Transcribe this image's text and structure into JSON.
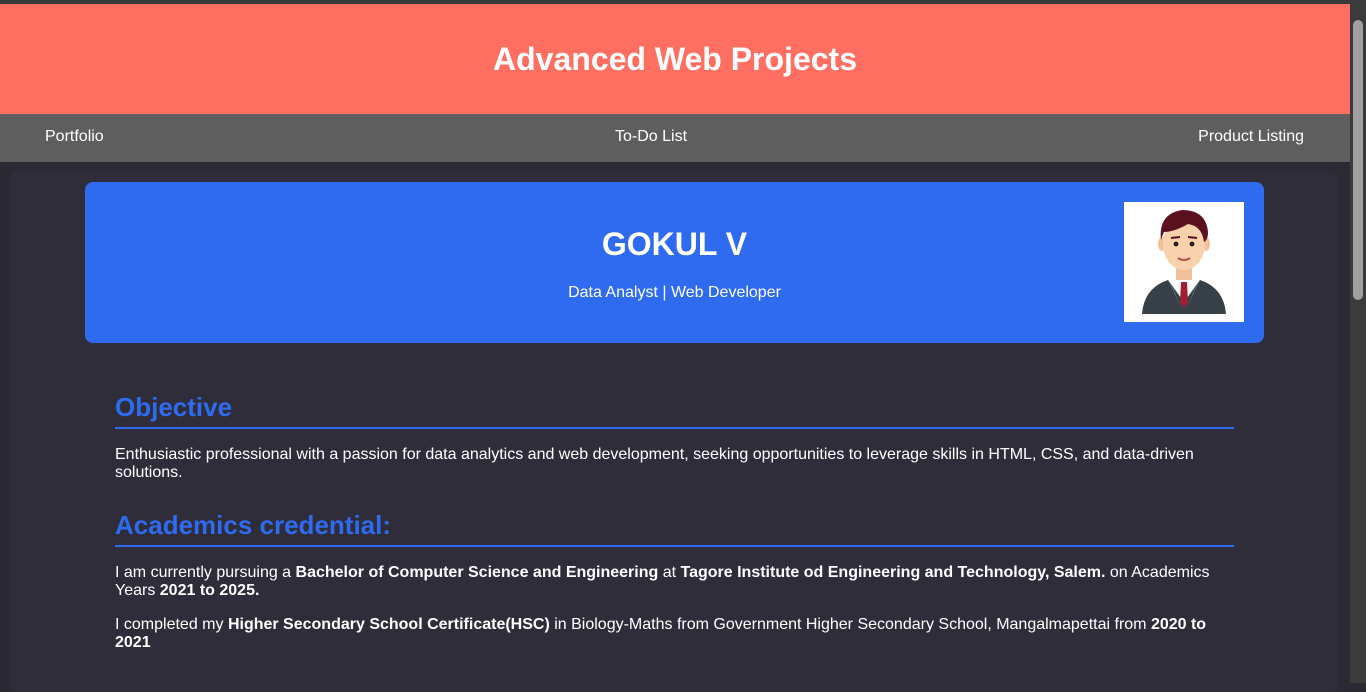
{
  "header": {
    "title": "Advanced Web Projects"
  },
  "nav": {
    "portfolio": "Portfolio",
    "todo": "To-Do List",
    "product": "Product Listing"
  },
  "profile": {
    "name": "GOKUL V",
    "role": "Data Analyst | Web Developer",
    "avatar_icon": "person-avatar-icon"
  },
  "objective": {
    "heading": "Objective",
    "text": "Enthusiastic professional with a passion for data analytics and web development, seeking opportunities to leverage skills in HTML, CSS, and data-driven solutions."
  },
  "academics": {
    "heading": "Academics credential:",
    "p1": {
      "t1": "I am currently pursuing a ",
      "b1": "Bachelor of Computer Science and Engineering",
      "t2": " at ",
      "b2": "Tagore Institute od Engineering and Technology, Salem.",
      "t3": " on Academics Years ",
      "b3": "2021 to 2025."
    },
    "p2": {
      "t1": "I completed my ",
      "b1": "Higher Secondary School Certificate(HSC)",
      "t2": " in Biology-Maths from Government Higher Secondary School, Mangalmapettai from ",
      "b2": "2020 to 2021"
    }
  },
  "colors": {
    "header_bg": "#ff6f61",
    "nav_bg": "#5e5e5e",
    "accent": "#2f6bef",
    "page_bg": "#2b2a33"
  }
}
